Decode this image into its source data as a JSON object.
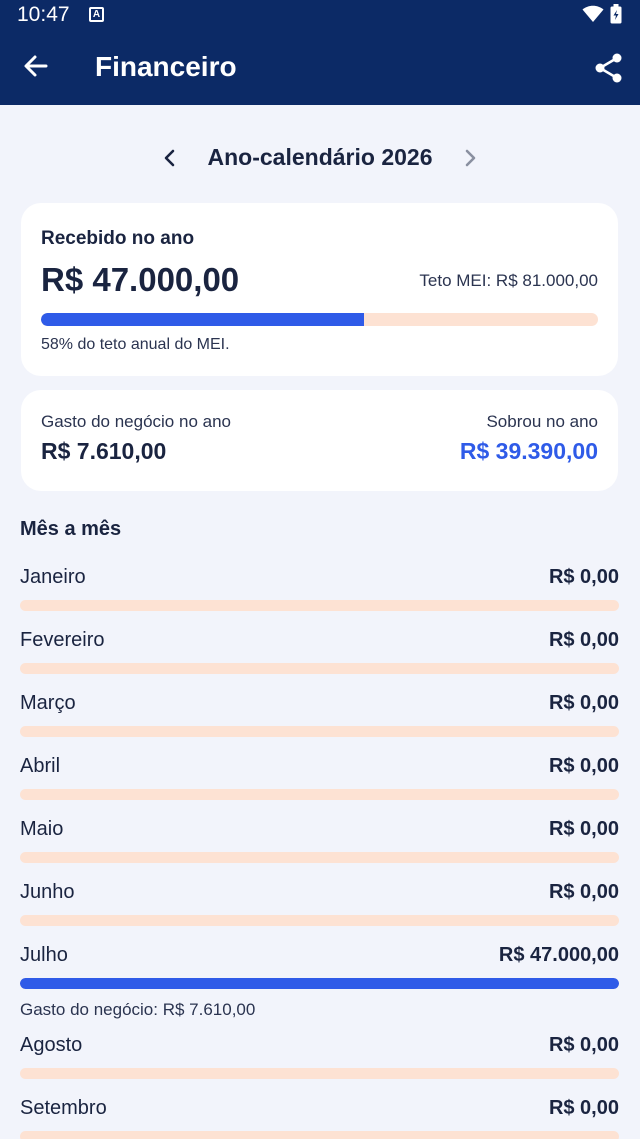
{
  "status": {
    "time": "10:47",
    "notif": "A"
  },
  "header": {
    "title": "Financeiro"
  },
  "year_nav": {
    "label": "Ano-calendário 2026"
  },
  "received": {
    "title": "Recebido no ano",
    "value": "R$ 47.000,00",
    "teto": "Teto MEI: R$ 81.000,00",
    "progress_fraction": 0.58,
    "caption": "58% do teto anual do MEI."
  },
  "summary": {
    "spent_label": "Gasto do negócio no ano",
    "spent_value": "R$ 7.610,00",
    "left_label": "Sobrou no ano",
    "left_value": "R$ 39.390,00"
  },
  "months_title": "Mês a mês",
  "months": [
    {
      "name": "Janeiro",
      "value": "R$ 0,00",
      "fraction": 0
    },
    {
      "name": "Fevereiro",
      "value": "R$ 0,00",
      "fraction": 0
    },
    {
      "name": "Março",
      "value": "R$ 0,00",
      "fraction": 0
    },
    {
      "name": "Abril",
      "value": "R$ 0,00",
      "fraction": 0
    },
    {
      "name": "Maio",
      "value": "R$ 0,00",
      "fraction": 0
    },
    {
      "name": "Junho",
      "value": "R$ 0,00",
      "fraction": 0
    },
    {
      "name": "Julho",
      "value": "R$ 47.000,00",
      "fraction": 1,
      "note": "Gasto do negócio: R$ 7.610,00"
    },
    {
      "name": "Agosto",
      "value": "R$ 0,00",
      "fraction": 0
    },
    {
      "name": "Setembro",
      "value": "R$ 0,00",
      "fraction": 0
    }
  ],
  "colors": {
    "header": "#0c2a66",
    "accent": "#2f5be8",
    "track": "#fde2d3",
    "background": "#f2f4fb"
  }
}
